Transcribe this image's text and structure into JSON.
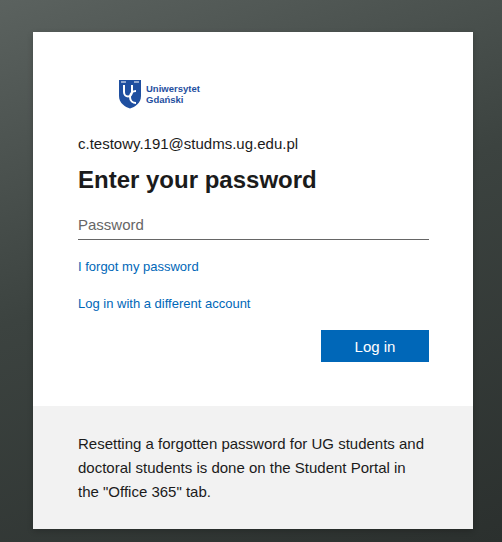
{
  "logo": {
    "lines": [
      "Uniwersytet",
      "Gdański"
    ]
  },
  "account": {
    "email": "c.testowy.191@studms.ug.edu.pl"
  },
  "title": "Enter your password",
  "password": {
    "placeholder": "Password",
    "value": ""
  },
  "links": [
    "I forgot my password",
    "Log in with a different account"
  ],
  "buttons": [
    "Log in"
  ],
  "footer": {
    "text": "Resetting a forgotten password for UG students and doctoral students is done on the Student Portal in the \"Office 365\" tab."
  }
}
